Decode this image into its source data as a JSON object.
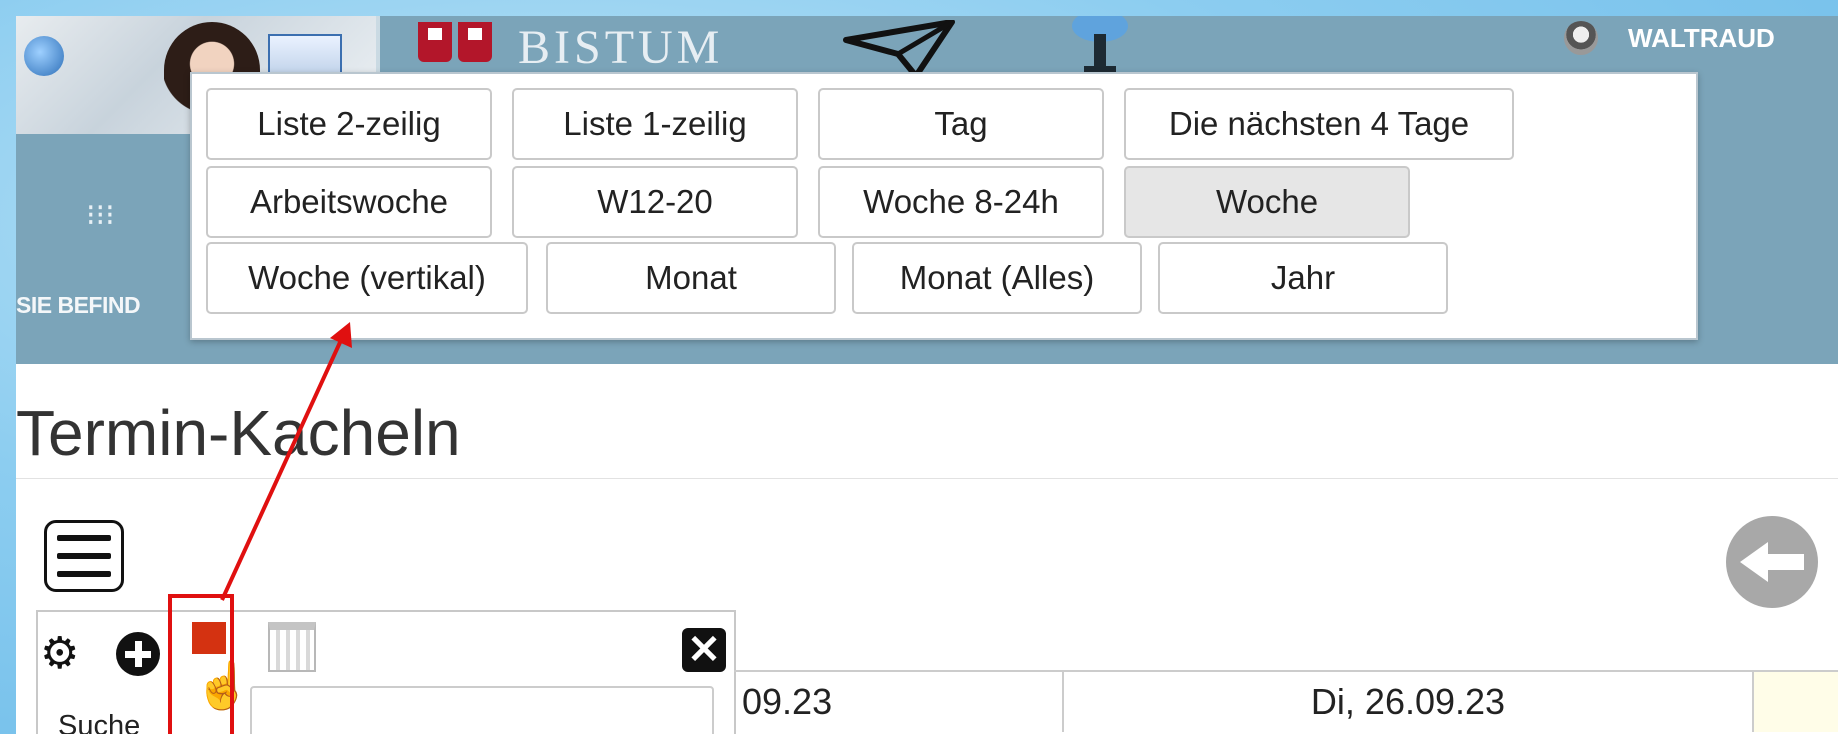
{
  "header": {
    "brand_text": "BISTUM",
    "user_name": "WALTRAUD",
    "location_label": "SIE BEFIND"
  },
  "view_menu": {
    "options": [
      {
        "label": "Liste 2-zeilig"
      },
      {
        "label": "Liste 1-zeilig"
      },
      {
        "label": "Tag"
      },
      {
        "label": "Die nächsten 4 Tage"
      },
      {
        "label": "Arbeitswoche"
      },
      {
        "label": "W12-20"
      },
      {
        "label": "Woche 8-24h"
      },
      {
        "label": "Woche",
        "selected": true
      },
      {
        "label": "Woche (vertikal)"
      },
      {
        "label": "Monat"
      },
      {
        "label": "Monat (Alles)"
      },
      {
        "label": "Jahr"
      }
    ]
  },
  "main": {
    "page_title": "Termin-Kacheln"
  },
  "panel": {
    "search_label": "Suche",
    "search_value": ""
  },
  "calendar": {
    "dates": [
      "09.23",
      "Di, 26.09.23"
    ]
  },
  "colors": {
    "header_bg": "#7ba4b9",
    "annotation_red": "#e01010",
    "accent_square": "#d43211"
  }
}
